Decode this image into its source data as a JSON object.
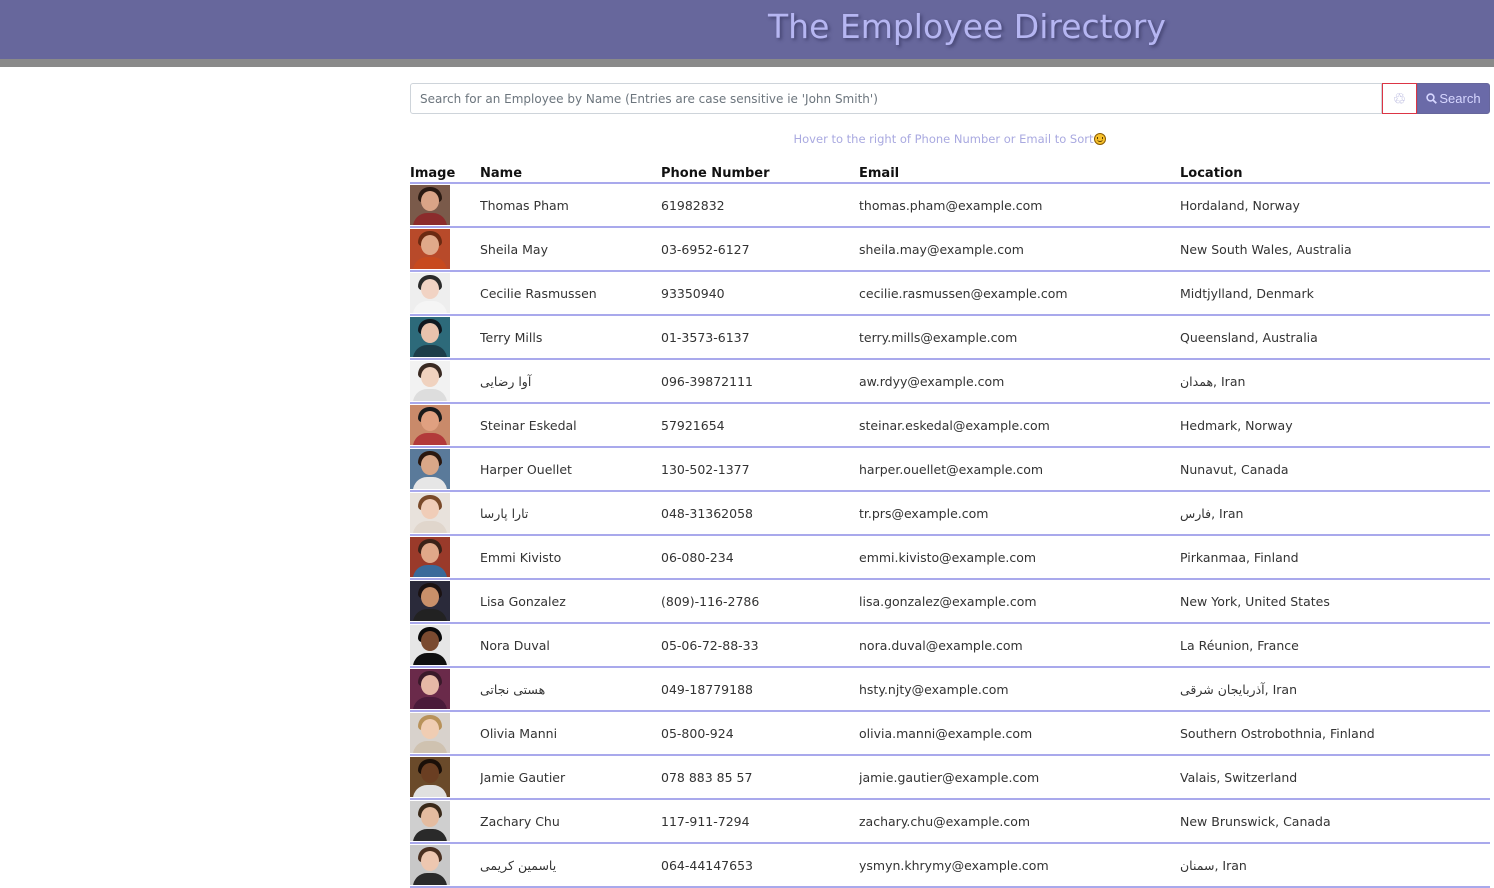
{
  "header": {
    "title": "The Employee Directory",
    "background": "#67679c",
    "title_color": "#b6b6f2"
  },
  "search": {
    "placeholder": "Search for an Employee by Name (Entries are case sensitive ie 'John Smith')",
    "value": "",
    "reset_icon": "recycle-icon",
    "button_icon": "magnifier-icon",
    "button_label": "Search"
  },
  "hint": {
    "text": "Hover to the right of Phone Number or Email to Sort",
    "icon": "smiley-icon"
  },
  "table": {
    "columns": {
      "image": "Image",
      "name": "Name",
      "phone": "Phone Number",
      "email": "Email",
      "location": "Location"
    },
    "rows": [
      {
        "name": "Thomas Pham",
        "phone": "61982832",
        "email": "thomas.pham@example.com",
        "location": "Hordaland, Norway",
        "avatar": {
          "bg": "#7a5a4a",
          "skin": "#d9a487",
          "hair": "#2a1a12",
          "shirt": "#8b2c2c"
        }
      },
      {
        "name": "Sheila May",
        "phone": "03-6952-6127",
        "email": "sheila.may@example.com",
        "location": "New South Wales, Australia",
        "avatar": {
          "bg": "#b84a2a",
          "skin": "#e0a98a",
          "hair": "#6b2a12",
          "shirt": "#c74a1e"
        }
      },
      {
        "name": "Cecilie Rasmussen",
        "phone": "93350940",
        "email": "cecilie.rasmussen@example.com",
        "location": "Midtjylland, Denmark",
        "avatar": {
          "bg": "#eeeeee",
          "skin": "#f1d3c4",
          "hair": "#2b2b2b",
          "shirt": "#f5f5f5"
        }
      },
      {
        "name": "Terry Mills",
        "phone": "01-3573-6137",
        "email": "terry.mills@example.com",
        "location": "Queensland, Australia",
        "avatar": {
          "bg": "#2d6a7a",
          "skin": "#e9c2ad",
          "hair": "#101820",
          "shirt": "#1c3d4a"
        }
      },
      {
        "name": "آوا رضایی",
        "phone": "096-39872111",
        "email": "aw.rdyy@example.com",
        "location": "همدان, Iran",
        "avatar": {
          "bg": "#f2f2f2",
          "skin": "#f0d2bf",
          "hair": "#3a2a22",
          "shirt": "#dddddd"
        }
      },
      {
        "name": "Steinar Eskedal",
        "phone": "57921654",
        "email": "steinar.eskedal@example.com",
        "location": "Hedmark, Norway",
        "avatar": {
          "bg": "#c98a6a",
          "skin": "#e0a080",
          "hair": "#1a1a1a",
          "shirt": "#b23a3a"
        }
      },
      {
        "name": "Harper Ouellet",
        "phone": "130-502-1377",
        "email": "harper.ouellet@example.com",
        "location": "Nunavut, Canada",
        "avatar": {
          "bg": "#5a7a9a",
          "skin": "#d9a788",
          "hair": "#2a1810",
          "shirt": "#e6e6e6"
        }
      },
      {
        "name": "تارا پارسا",
        "phone": "048-31362058",
        "email": "tr.prs@example.com",
        "location": "فارس, Iran",
        "avatar": {
          "bg": "#e8e2dc",
          "skin": "#f0cdb8",
          "hair": "#7a4a2a",
          "shirt": "#e0d6cc"
        }
      },
      {
        "name": "Emmi Kivisto",
        "phone": "06-080-234",
        "email": "emmi.kivisto@example.com",
        "location": "Pirkanmaa, Finland",
        "avatar": {
          "bg": "#9a3a2a",
          "skin": "#e0a889",
          "hair": "#3a2218",
          "shirt": "#3a6a9a"
        }
      },
      {
        "name": "Lisa Gonzalez",
        "phone": "(809)-116-2786",
        "email": "lisa.gonzalez@example.com",
        "location": "New York, United States",
        "avatar": {
          "bg": "#2a2a3a",
          "skin": "#c9906a",
          "hair": "#1a1212",
          "shirt": "#222222"
        }
      },
      {
        "name": "Nora Duval",
        "phone": "05-06-72-88-33",
        "email": "nora.duval@example.com",
        "location": "La Réunion, France",
        "avatar": {
          "bg": "#e6e6e6",
          "skin": "#7a4a30",
          "hair": "#0a0a0a",
          "shirt": "#101010"
        }
      },
      {
        "name": "هستی نجاتی",
        "phone": "049-18779188",
        "email": "hsty.njty@example.com",
        "location": "آذربایجان شرقی, Iran",
        "avatar": {
          "bg": "#6a2a4a",
          "skin": "#e6b8a6",
          "hair": "#3a1a2a",
          "shirt": "#4a1a3a"
        }
      },
      {
        "name": "Olivia Manni",
        "phone": "05-800-924",
        "email": "olivia.manni@example.com",
        "location": "Southern Ostrobothnia, Finland",
        "avatar": {
          "bg": "#d8d2cc",
          "skin": "#f0cdb3",
          "hair": "#b8925a",
          "shirt": "#cfc2b0"
        }
      },
      {
        "name": "Jamie Gautier",
        "phone": "078 883 85 57",
        "email": "jamie.gautier@example.com",
        "location": "Valais, Switzerland",
        "avatar": {
          "bg": "#6a4a2a",
          "skin": "#6a3e22",
          "hair": "#1a0f08",
          "shirt": "#e0e0e0"
        }
      },
      {
        "name": "Zachary Chu",
        "phone": "117-911-7294",
        "email": "zachary.chu@example.com",
        "location": "New Brunswick, Canada",
        "avatar": {
          "bg": "#cfcfcf",
          "skin": "#e4bca0",
          "hair": "#3a2a1a",
          "shirt": "#2a2a2a"
        }
      },
      {
        "name": "یاسمین کریمی",
        "phone": "064-44147653",
        "email": "ysmyn.khrymy@example.com",
        "location": "سمنان, Iran",
        "avatar": {
          "bg": "#c8c8c8",
          "skin": "#edc7b0",
          "hair": "#4a3020",
          "shirt": "#2a2a2a"
        }
      }
    ]
  }
}
